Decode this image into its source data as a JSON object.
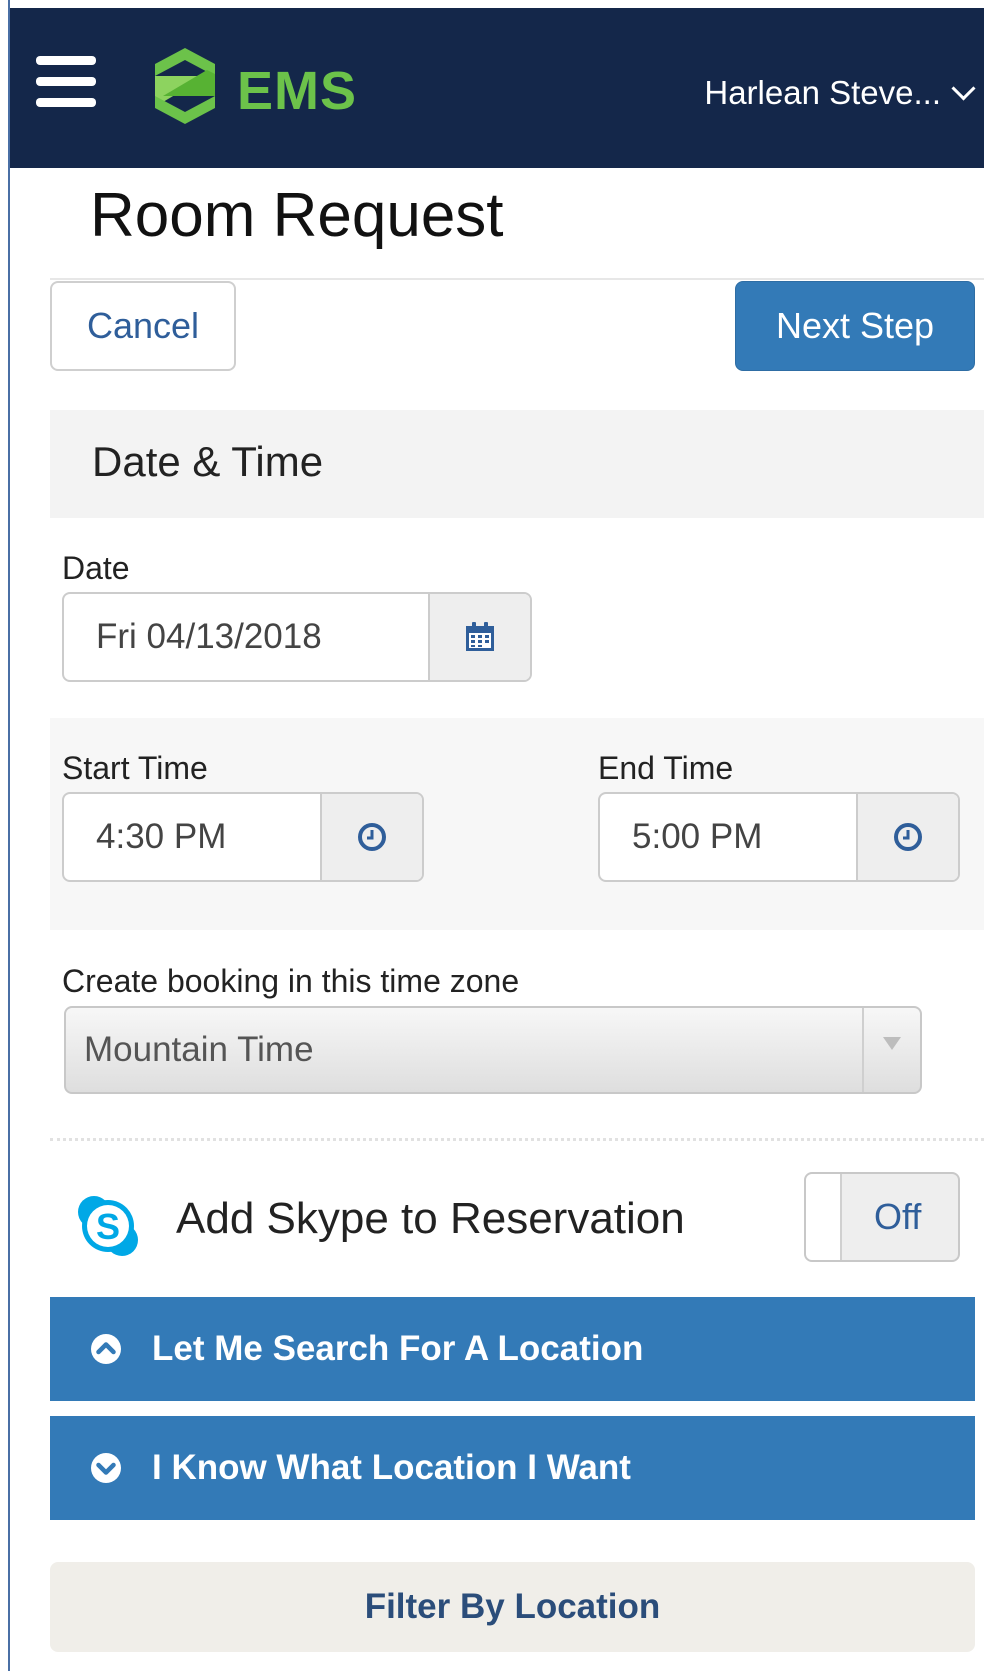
{
  "header": {
    "logo_text": "EMS",
    "user_name": "Harlean Steve..."
  },
  "page": {
    "title": "Room Request"
  },
  "actions": {
    "cancel_label": "Cancel",
    "next_label": "Next Step"
  },
  "date_time": {
    "section_title": "Date & Time",
    "date_label": "Date",
    "date_value": "Fri 04/13/2018",
    "start_label": "Start Time",
    "start_value": "4:30 PM",
    "end_label": "End Time",
    "end_value": "5:00 PM",
    "timezone_label": "Create booking in this time zone",
    "timezone_value": "Mountain Time"
  },
  "skype": {
    "label": "Add Skype to Reservation",
    "toggle_state": "Off"
  },
  "location": {
    "search_label": "Let Me Search For A Location",
    "known_label": "I Know What Location I Want",
    "filter_label": "Filter By Location"
  },
  "colors": {
    "header_bg": "#14274a",
    "primary": "#337ab7",
    "logo_green": "#6cc24a"
  },
  "icons": {
    "menu": "hamburger-icon",
    "calendar": "calendar-icon",
    "clock": "clock-icon",
    "skype": "skype-icon",
    "chevron_up": "chevron-up-circle-icon",
    "chevron_down": "chevron-down-circle-icon"
  }
}
